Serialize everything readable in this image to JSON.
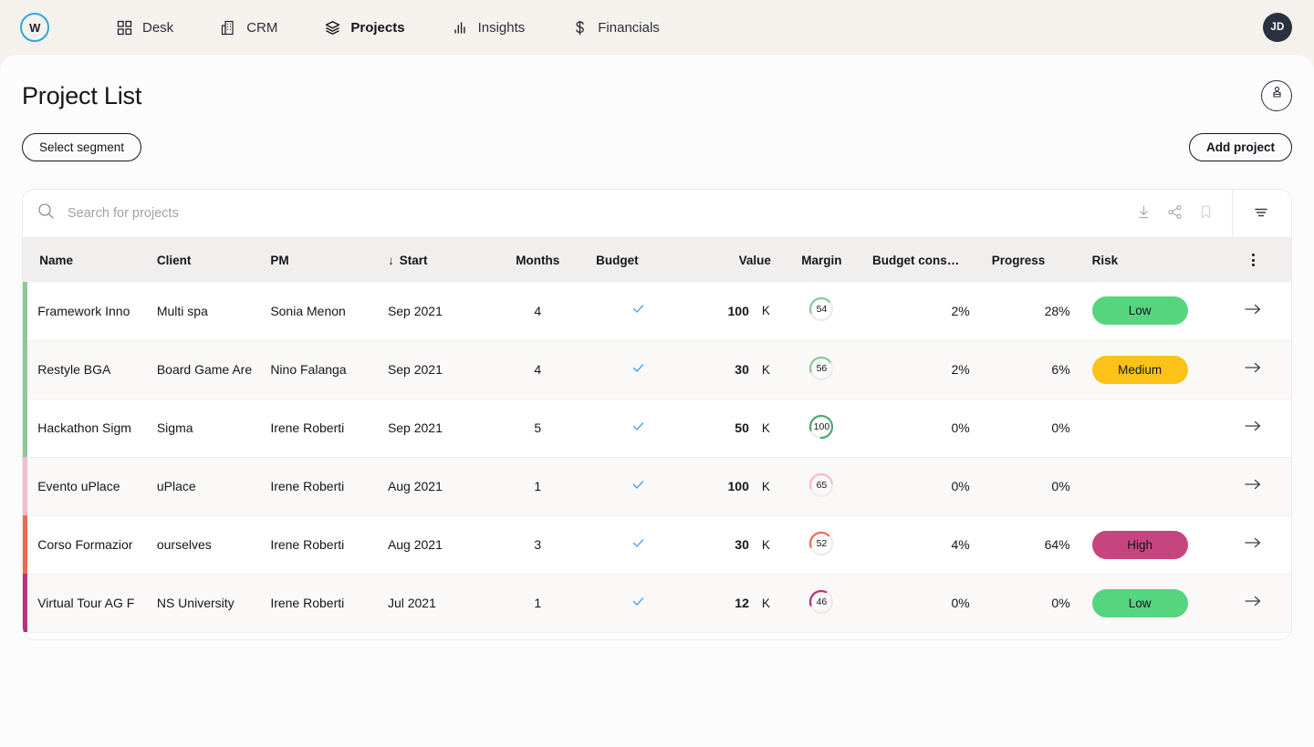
{
  "brand": {
    "logo_text": "W",
    "logo_ring_color": "#2aa8e0"
  },
  "topnav": {
    "items": [
      {
        "label": "Desk",
        "icon": "grid-icon",
        "active": false
      },
      {
        "label": "CRM",
        "icon": "building-icon",
        "active": false
      },
      {
        "label": "Projects",
        "icon": "layers-icon",
        "active": true
      },
      {
        "label": "Insights",
        "icon": "bar-chart-icon",
        "active": false
      },
      {
        "label": "Financials",
        "icon": "dollar-icon",
        "active": false
      }
    ],
    "avatar_initials": "JD"
  },
  "header": {
    "title": "Project List",
    "profile_icon": "briefcase-person-icon"
  },
  "actions": {
    "select_segment_label": "Select segment",
    "add_project_label": "Add project"
  },
  "search": {
    "placeholder": "Search for projects",
    "value": "",
    "icons": [
      "download-icon",
      "share-icon",
      "bookmark-icon",
      "filter-icon"
    ]
  },
  "table": {
    "columns": [
      {
        "key": "name",
        "label": "Name",
        "align": "left"
      },
      {
        "key": "client",
        "label": "Client",
        "align": "left"
      },
      {
        "key": "pm",
        "label": "PM",
        "align": "left"
      },
      {
        "key": "start",
        "label": "Start",
        "align": "left",
        "sorted": true,
        "sort_dir": "↓"
      },
      {
        "key": "months",
        "label": "Months",
        "align": "center"
      },
      {
        "key": "budget",
        "label": "Budget",
        "align": "left"
      },
      {
        "key": "value",
        "label": "Value",
        "align": "right"
      },
      {
        "key": "margin",
        "label": "Margin",
        "align": "center"
      },
      {
        "key": "budgetc",
        "label": "Budget cons…",
        "align": "right"
      },
      {
        "key": "progress",
        "label": "Progress",
        "align": "right"
      },
      {
        "key": "risk",
        "label": "Risk",
        "align": "left"
      }
    ],
    "menu_icon": "kebab-menu-icon",
    "rows": [
      {
        "accent": "#8cc99a",
        "stripe": "odd",
        "name": "Framework Inno",
        "client": "Multi spa",
        "pm": "Sonia Menon",
        "start": "Sep 2021",
        "months": "4",
        "budget_check": true,
        "value": "100",
        "value_unit": "K",
        "margin": "54",
        "margin_color": "#8cc99a",
        "budget_consumed": "2%",
        "progress": "28%",
        "risk": "Low",
        "risk_color": "#56d57f",
        "row_arrow": "→"
      },
      {
        "accent": "#8cc99a",
        "stripe": "even",
        "name": "Restyle BGA",
        "client": "Board Game Are",
        "pm": "Nino Falanga",
        "start": "Sep 2021",
        "months": "4",
        "budget_check": true,
        "value": "30",
        "value_unit": "K",
        "margin": "56",
        "margin_color": "#8cc99a",
        "budget_consumed": "2%",
        "progress": "6%",
        "risk": "Medium",
        "risk_color": "#fcc218",
        "row_arrow": "→"
      },
      {
        "accent": "#8cc99a",
        "stripe": "odd",
        "name": "Hackathon Sigm",
        "client": "Sigma",
        "pm": "Irene Roberti",
        "start": "Sep 2021",
        "months": "5",
        "budget_check": true,
        "value": "50",
        "value_unit": "K",
        "margin": "100",
        "margin_color": "#4fa968",
        "budget_consumed": "0%",
        "progress": "0%",
        "risk": "",
        "risk_color": "",
        "row_arrow": "→"
      },
      {
        "accent": "#f7b9d0",
        "stripe": "even",
        "name": "Evento uPlace",
        "client": "uPlace",
        "pm": "Irene Roberti",
        "start": "Aug 2021",
        "months": "1",
        "budget_check": true,
        "value": "100",
        "value_unit": "K",
        "margin": "65",
        "margin_color": "#f7b9d0",
        "budget_consumed": "0%",
        "progress": "0%",
        "risk": "",
        "risk_color": "",
        "row_arrow": "→"
      },
      {
        "accent": "#ee6c4d",
        "stripe": "odd",
        "name": "Corso Formazior",
        "client": "ourselves",
        "pm": "Irene Roberti",
        "start": "Aug 2021",
        "months": "3",
        "budget_check": true,
        "value": "30",
        "value_unit": "K",
        "margin": "52",
        "margin_color": "#ee6c4d",
        "budget_consumed": "4%",
        "progress": "64%",
        "risk": "High",
        "risk_color": "#c7457e",
        "row_arrow": "→"
      },
      {
        "accent": "#b8327c",
        "stripe": "even",
        "name": "Virtual Tour AG F",
        "client": "NS University",
        "pm": "Irene Roberti",
        "start": "Jul 2021",
        "months": "1",
        "budget_check": true,
        "value": "12",
        "value_unit": "K",
        "margin": "46",
        "margin_color": "#b8327c",
        "budget_consumed": "0%",
        "progress": "0%",
        "risk": "Low",
        "risk_color": "#56d57f",
        "row_arrow": "→"
      }
    ]
  }
}
